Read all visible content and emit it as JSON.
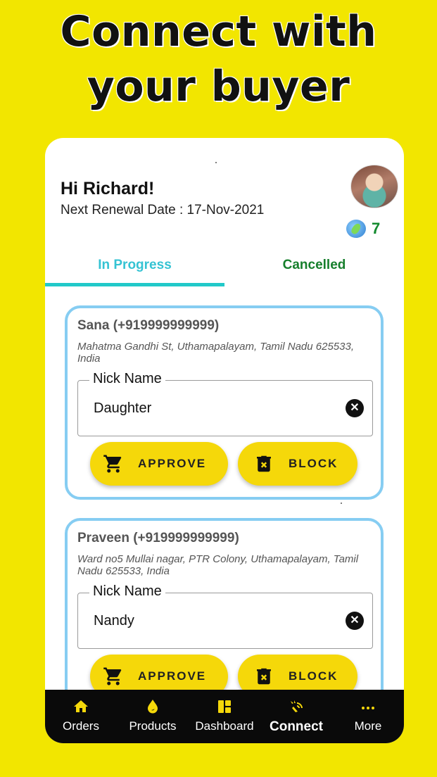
{
  "headline": {
    "line1": "Connect with",
    "line2": "your buyer"
  },
  "header": {
    "greeting": "Hi Richard!",
    "renewal": "Next Renewal Date : 17-Nov-2021",
    "coin_count": "7"
  },
  "tabs": [
    {
      "label": "In Progress",
      "active": true
    },
    {
      "label": "Cancelled",
      "active": false
    }
  ],
  "buyers": [
    {
      "name": "Sana (+919999999999)",
      "address": "Mahatma Gandhi St, Uthamapalayam, Tamil Nadu 625533, India",
      "nick_label": "Nick Name",
      "nick_value": "Daughter",
      "approve_label": "APPROVE",
      "block_label": "BLOCK"
    },
    {
      "name": "Praveen (+919999999999)",
      "address": "Ward no5 Mullai nagar, PTR Colony, Uthamapalayam, Tamil Nadu 625533, India",
      "nick_label": "Nick Name",
      "nick_value": "Nandy",
      "approve_label": "APPROVE",
      "block_label": "BLOCK"
    }
  ],
  "bottom_nav": [
    {
      "label": "Orders",
      "icon": "home-icon"
    },
    {
      "label": "Products",
      "icon": "drop-icon"
    },
    {
      "label": "Dashboard",
      "icon": "dashboard-icon"
    },
    {
      "label": "Connect",
      "icon": "connect-icon",
      "active": true
    },
    {
      "label": "More",
      "icon": "more-icon"
    }
  ],
  "colors": {
    "background": "#f2e600",
    "accent": "#f5d80a",
    "tab_active": "#35c3d3",
    "tab_inactive": "#167f2c",
    "card_border": "#86cdf2"
  }
}
